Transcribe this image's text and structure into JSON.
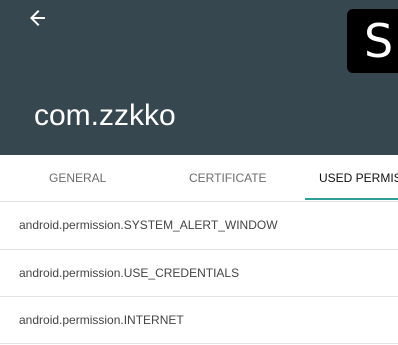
{
  "header": {
    "background_color": "#37474f",
    "back_icon": "arrow-back-icon",
    "app_icon_letter": "S",
    "package_name": "com.zzkko"
  },
  "tabs": [
    {
      "label": "GENERAL",
      "active": false
    },
    {
      "label": "CERTIFICATE",
      "active": false
    },
    {
      "label": "USED PERMIS",
      "active": true
    }
  ],
  "accent_color": "#2f9e94",
  "permissions": [
    "android.permission.SYSTEM_ALERT_WINDOW",
    "android.permission.USE_CREDENTIALS",
    "android.permission.INTERNET"
  ]
}
